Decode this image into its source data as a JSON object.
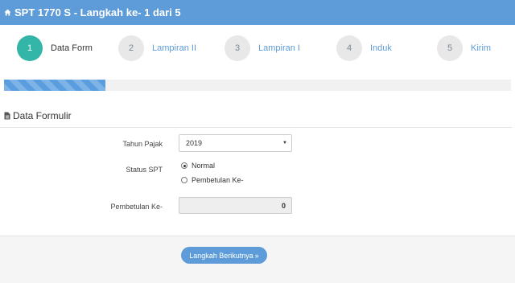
{
  "header": {
    "title": "SPT 1770 S - Langkah ke- 1 dari 5",
    "icon": "home-icon"
  },
  "steps": [
    {
      "number": "1",
      "label": "Data Form",
      "active": true
    },
    {
      "number": "2",
      "label": "Lampiran II",
      "active": false
    },
    {
      "number": "3",
      "label": "Lampiran I",
      "active": false
    },
    {
      "number": "4",
      "label": "Induk",
      "active": false
    },
    {
      "number": "5",
      "label": "Kirim",
      "active": false
    }
  ],
  "progress": {
    "fraction": 0.2
  },
  "section": {
    "title": "Data Formulir",
    "icon": "document-icon"
  },
  "form": {
    "tahun_pajak": {
      "label": "Tahun Pajak",
      "value": "2019"
    },
    "status_spt": {
      "label": "Status SPT",
      "options": [
        "Normal",
        "Pembetulan Ke-"
      ],
      "selected": "Normal"
    },
    "pembetulan": {
      "label": "Pembetulan Ke-",
      "value": "0"
    }
  },
  "footer": {
    "next_label": "Langkah Berikutnya"
  },
  "colors": {
    "accent": "#5d9cd8",
    "active_step": "#33b5a8",
    "inactive_step": "#e8e8e8"
  }
}
